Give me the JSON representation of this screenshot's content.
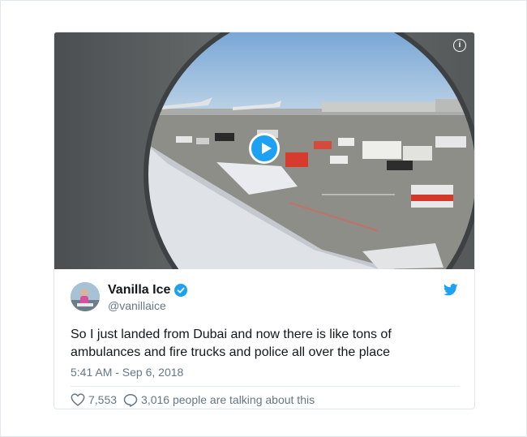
{
  "media": {
    "info_icon": "i",
    "play_icon": "play-icon"
  },
  "author": {
    "name": "Vanilla Ice",
    "handle": "@vanillaice",
    "verified": true
  },
  "tweet": {
    "text": "So I just landed from Dubai and now there is like tons of ambulances and fire trucks and police all over the place",
    "timestamp": "5:41 AM - Sep 6, 2018"
  },
  "stats": {
    "likes": "7,553",
    "talking": "3,016 people are talking about this"
  },
  "colors": {
    "accent": "#1da1f2",
    "text": "#14171a",
    "muted": "#657786",
    "border": "#e1e8ed"
  }
}
